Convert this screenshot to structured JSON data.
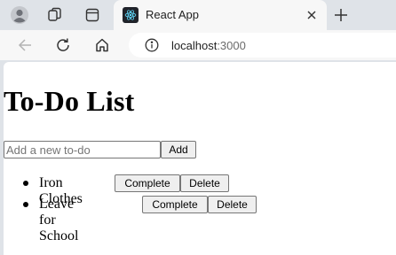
{
  "browser": {
    "tab": {
      "title": "React App"
    },
    "address": {
      "host": "localhost",
      "port": ":3000"
    }
  },
  "page": {
    "title": "To-Do List",
    "new_todo": {
      "value": "",
      "placeholder": "Add a new to-do",
      "add_label": "Add"
    },
    "todos": [
      {
        "text": "Iron Clothes",
        "complete_label": "Complete",
        "delete_label": "Delete"
      },
      {
        "text": "Leave for School",
        "complete_label": "Complete",
        "delete_label": "Delete"
      }
    ]
  },
  "colors": {
    "tabstrip_bg": "#dfe3e8",
    "toolbar_bg": "#f7f7f7",
    "react_favicon": "#61dafb"
  },
  "icons": [
    "profile-icon",
    "workspaces-icon",
    "tab-actions-icon",
    "react-icon",
    "close-icon",
    "plus-icon",
    "back-arrow-icon",
    "reload-icon",
    "home-icon",
    "info-icon"
  ]
}
